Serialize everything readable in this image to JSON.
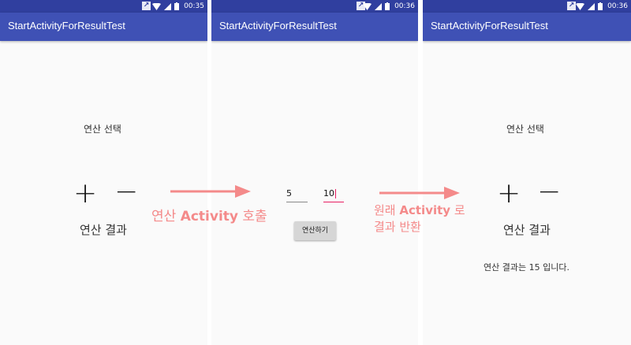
{
  "app_title": "StartActivityForResultTest",
  "screens": [
    {
      "time": "00:35",
      "operation_label": "연산 선택",
      "plus_symbol": "+",
      "minus_symbol": "−",
      "result_label": "연산 결과"
    },
    {
      "time": "00:36",
      "input_a": "5",
      "input_b": "10",
      "compute_button": "연산하기"
    },
    {
      "time": "00:36",
      "operation_label": "연산 선택",
      "plus_symbol": "+",
      "minus_symbol": "−",
      "result_label": "연산 결과",
      "result_text": "연산 결과는 15 입니다."
    }
  ],
  "annotations": {
    "call": {
      "prefix": "연산 ",
      "bold": "Activity",
      "suffix": " 호출"
    },
    "return": {
      "line1_prefix": "원래 ",
      "line1_bold": "Activity",
      "line1_suffix": " 로",
      "line2": "결과 반환"
    }
  },
  "colors": {
    "status_bar": "#303f9f",
    "app_bar": "#3f51b5",
    "accent": "#e91e63",
    "annotation": "#f48a8a"
  }
}
